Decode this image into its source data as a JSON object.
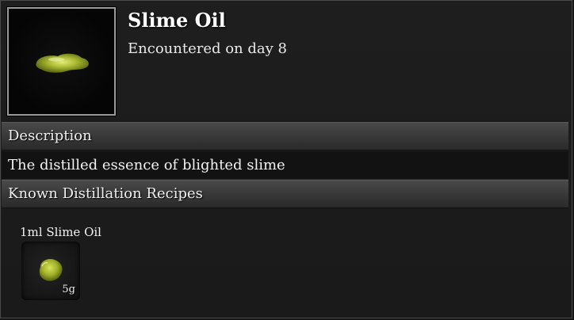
{
  "item": {
    "name": "Slime Oil",
    "encountered": "Encountered on day 8",
    "icon": "slime-oil-puddle-icon"
  },
  "sections": {
    "description_header": "Description",
    "description_text": "The distilled essence of blighted slime",
    "recipes_header": "Known Distillation Recipes"
  },
  "recipes": [
    {
      "name": "1ml Slime Oil",
      "quantity": "5g",
      "icon": "slime-blob-icon"
    }
  ],
  "colors": {
    "slime": "#a8b832",
    "slime_dark": "#5f6b12"
  }
}
